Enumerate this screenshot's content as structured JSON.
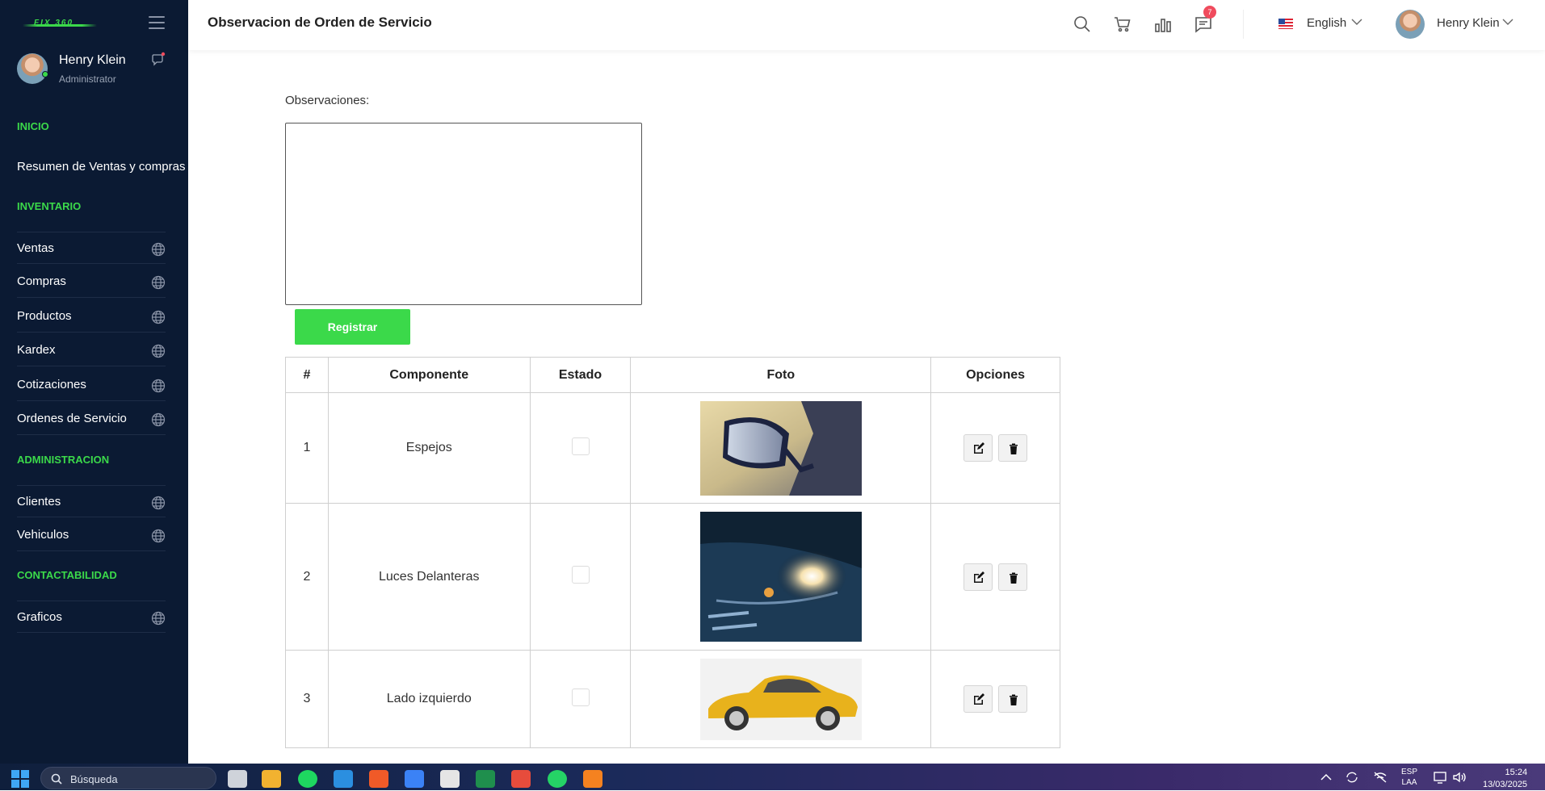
{
  "sidebar": {
    "logo_text": "FIX 360",
    "profile": {
      "name": "Henry Klein",
      "role": "Administrator"
    },
    "sections": {
      "inicio": "INICIO",
      "inventario": "INVENTARIO",
      "administracion": "ADMINISTRACION",
      "contactabilidad": "CONTACTABILIDAD"
    },
    "items": {
      "resumen": "Resumen de Ventas y compras",
      "ventas": "Ventas",
      "compras": "Compras",
      "productos": "Productos",
      "kardex": "Kardex",
      "cotizaciones": "Cotizaciones",
      "ordenes": "Ordenes de Servicio",
      "clientes": "Clientes",
      "vehiculos": "Vehiculos",
      "graficos": "Graficos"
    }
  },
  "header": {
    "title": "Observacion de Orden de Servicio",
    "notification_count": "7",
    "language": "English",
    "user_name": "Henry Klein"
  },
  "form": {
    "observaciones_label": "Observaciones:",
    "observaciones_value": "",
    "register_label": "Registrar"
  },
  "table": {
    "headers": {
      "num": "#",
      "componente": "Componente",
      "estado": "Estado",
      "foto": "Foto",
      "opciones": "Opciones"
    },
    "rows": [
      {
        "num": "1",
        "componente": "Espejos",
        "estado": false
      },
      {
        "num": "2",
        "componente": "Luces Delanteras",
        "estado": false
      },
      {
        "num": "3",
        "componente": "Lado izquierdo",
        "estado": false
      }
    ]
  },
  "taskbar": {
    "search_placeholder": "Búsqueda",
    "lang_top": "ESP",
    "lang_bottom": "LAA",
    "time": "15:24",
    "date": "13/03/2025"
  },
  "colors": {
    "accent": "#3bd94a",
    "sidebar_bg": "#0b1a33",
    "badge": "#f04b5d"
  }
}
